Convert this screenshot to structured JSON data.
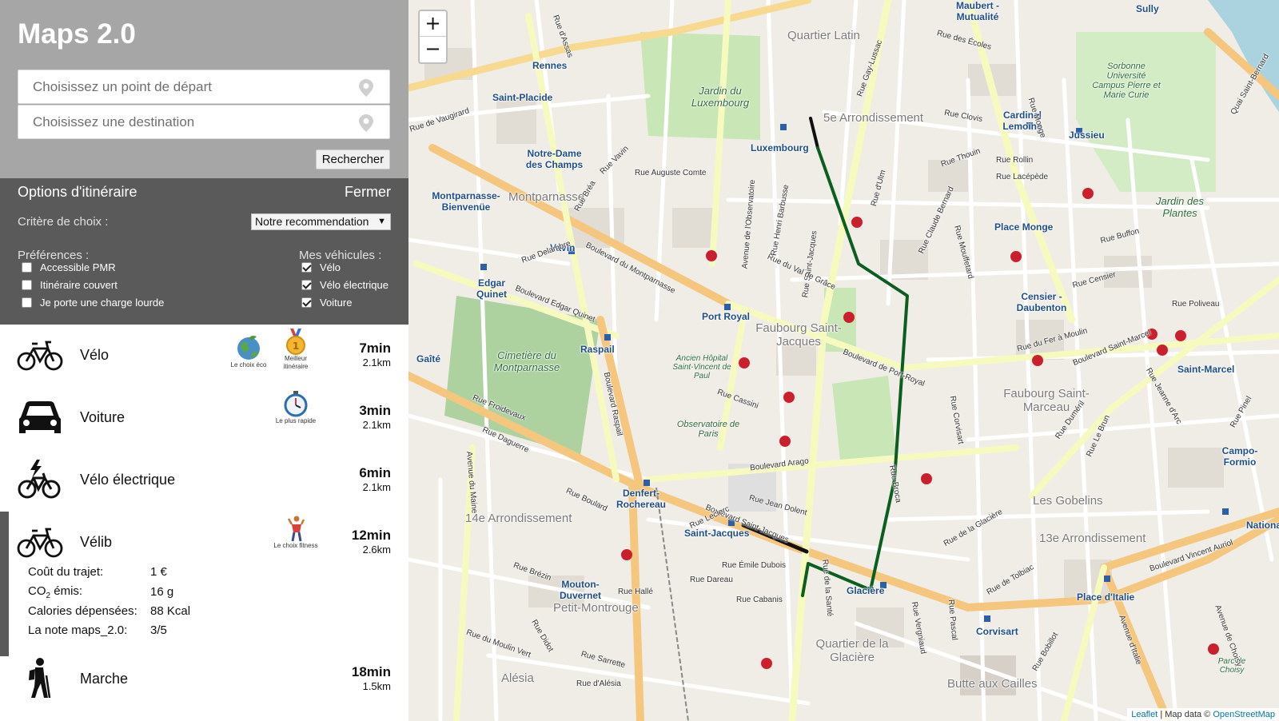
{
  "app": {
    "title": "Maps 2.0"
  },
  "search": {
    "start_placeholder": "Choisissez un point de départ",
    "dest_placeholder": "Choisissez une destination",
    "submit_label": "Rechercher"
  },
  "options": {
    "title": "Options d'itinéraire",
    "close_label": "Fermer",
    "criterion_label": "Critère de choix :",
    "criterion_value": "Notre recommendation",
    "preferences_label": "Préférences :",
    "preferences": [
      {
        "label": "Accessible PMR",
        "checked": false
      },
      {
        "label": "Itinéraire couvert",
        "checked": false
      },
      {
        "label": "Je porte une charge lourde",
        "checked": false
      }
    ],
    "vehicles_label": "Mes véhicules :",
    "vehicles": [
      {
        "label": "Vélo",
        "checked": true
      },
      {
        "label": "Vélo électrique",
        "checked": true
      },
      {
        "label": "Voiture",
        "checked": true
      }
    ]
  },
  "routes": [
    {
      "mode": "Vélo",
      "icon": "bicycle-icon",
      "time": "7min",
      "distance": "2.1km",
      "badges": [
        {
          "icon": "earth-icon",
          "label": "Le choix éco"
        },
        {
          "icon": "medal-icon",
          "label": "Meilleur itinéraire"
        }
      ]
    },
    {
      "mode": "Voiture",
      "icon": "car-icon",
      "time": "3min",
      "distance": "2.1km",
      "badges": [
        {
          "icon": "stopwatch-icon",
          "label": "Le plus rapide"
        }
      ]
    },
    {
      "mode": "Vélo électrique",
      "icon": "electric-bicycle-icon",
      "time": "6min",
      "distance": "2.1km",
      "badges": []
    },
    {
      "mode": "Vélib",
      "icon": "bicycle-icon",
      "time": "12min",
      "distance": "2.6km",
      "badges": [
        {
          "icon": "fitness-icon",
          "label": "Le choix fitness"
        }
      ]
    },
    {
      "mode": "Marche",
      "icon": "hiker-icon",
      "time": "18min",
      "distance": "1.5km",
      "badges": []
    }
  ],
  "velib_details": {
    "cost_label": "Coût du trajet:",
    "cost_value": "1 €",
    "co2_label_main": "CO",
    "co2_label_sub": "2",
    "co2_label_rest": " émis:",
    "co2_value": "16 g",
    "calories_label": "Calories dépensées:",
    "calories_value": "88 Kcal",
    "rating_label": "La note maps_2.0:",
    "rating_value": "3/5"
  },
  "map": {
    "zoom_in": "+",
    "zoom_out": "−",
    "attribution_leaflet": "Leaflet",
    "attribution_sep": " | Map data © ",
    "attribution_osm": "OpenStreetMap",
    "route_color": "#0b5e20",
    "districts": [
      "Quartier Latin",
      "5e Arrondissement",
      "Montparnasse",
      "Faubourg Saint-Jacques",
      "Faubourg Saint-Marceau",
      "Les Gobelins",
      "13e Arrondissement",
      "14e Arrondissement",
      "Petit-Montrouge",
      "Quartier de la Glacière",
      "Butte aux Cailles",
      "Alésia"
    ],
    "parks": [
      "Jardin du Luxembourg",
      "Cimetière du Montparnasse",
      "Jardin des Plantes",
      "Observatoire de Paris",
      "Sorbonne Université Campus Pierre et Marie Curie",
      "Ancien Hôpital Saint-Vincent de Paul",
      "Parc de Choisy"
    ],
    "stations": [
      "Rennes",
      "Saint-Placide",
      "Notre-Dame des Champs",
      "Montparnasse-Bienvenüe",
      "Vavin",
      "Edgar Quinet",
      "Raspail",
      "Gaîté",
      "Port Royal",
      "Luxembourg",
      "Cardinal Lemoine",
      "Jussieu",
      "Place Monge",
      "Censier - Daubenton",
      "Saint-Marcel",
      "Campo-Formio",
      "Denfert-Rochereau",
      "Saint-Jacques",
      "Glacière",
      "Corvisart",
      "Place d'Italie",
      "Mouton-Duvernet",
      "Maubert - Mutualité",
      "Nationale",
      "Sully"
    ],
    "streets": [
      "Boulevard du Montparnasse",
      "Boulevard Edgar Quinet",
      "Boulevard Raspail",
      "Rue Saint-Jacques",
      "Boulevard de Port-Royal",
      "Boulevard Arago",
      "Boulevard Saint-Marcel",
      "Rue Froidevaux",
      "Avenue du Maine",
      "Rue Monge",
      "Rue Mouffetard",
      "Boulevard Vincent Auriol",
      "Avenue d'Italie",
      "Avenue de Choisy",
      "Rue de Vaugirard",
      "Rue d'Assas",
      "Rue de la Santé",
      "Boulevard Saint-Jacques",
      "Avenue de l'Observatoire",
      "Quai Saint-Bernard",
      "Rue Gay-Lussac",
      "Rue d'Ulm",
      "Rue Claude Bernard",
      "Rue de Tolbiac",
      "Rue de la Glacière",
      "Rue Pascal",
      "Rue Broca",
      "Rue Auguste Comte",
      "Rue Vavin",
      "Rue Bréa",
      "Rue Delambre",
      "Rue Daguerre",
      "Rue Boulard",
      "Rue Brézin",
      "Rue Hallé",
      "Rue Cabanis",
      "Rue Dareau",
      "Rue Émile Dubois",
      "Rue Jean Dolent",
      "Rue Leclerc",
      "Rue Cassini",
      "Rue du Val de Grâce",
      "Rue Henri Barbusse",
      "Rue des Écoles",
      "Rue Clovis",
      "Rue Thouin",
      "Rue Rollin",
      "Rue Lacépède",
      "Rue Buffon",
      "Rue Censier",
      "Rue du Fer à Moulin",
      "Rue Poliveau",
      "Rue Jeanne d'Arc",
      "Rue Pinel",
      "Rue Duméril",
      "Rue Le Brun",
      "Rue Corvisart",
      "Rue Vergniaud",
      "Rue Bobillot",
      "Rue d'Alésia",
      "Rue du Moulin Vert",
      "Rue Didot",
      "Rue Sarrette"
    ]
  }
}
